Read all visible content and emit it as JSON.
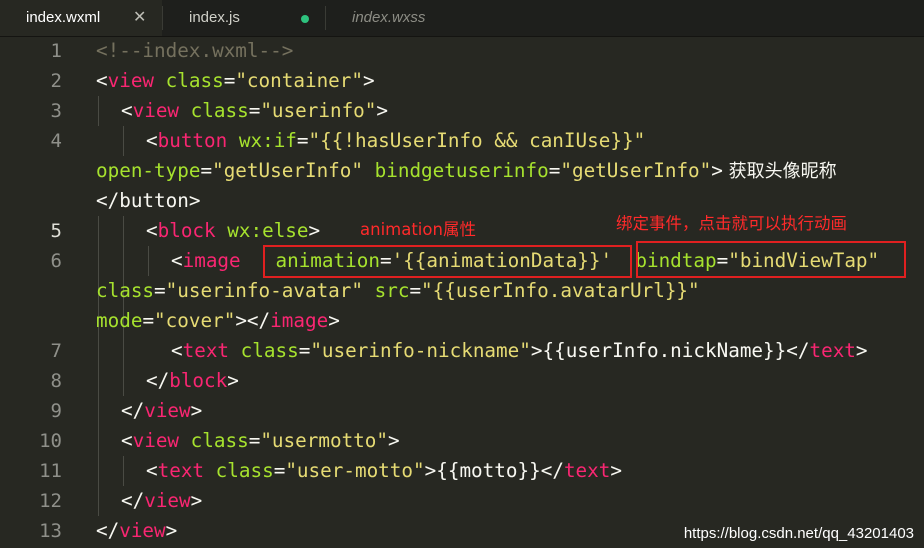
{
  "tabs": [
    {
      "label": "index.wxml",
      "close_glyph": "✕"
    },
    {
      "label": "index.js"
    },
    {
      "label": "index.wxss"
    }
  ],
  "line_numbers": [
    "1",
    "2",
    "3",
    "4",
    "5",
    "6",
    "7",
    "8",
    "9",
    "10",
    "11",
    "12",
    "13"
  ],
  "code": {
    "l1": "<!--index.wxml-->",
    "l2_lt": "<",
    "l2_tag": "view",
    "l2_attr": "class",
    "l2_val": "\"container\"",
    "l2_gt": ">",
    "l3_lt": "<",
    "l3_tag": "view",
    "l3_attr": "class",
    "l3_val": "\"userinfo\"",
    "l3_gt": ">",
    "l4_lt": "<",
    "l4_tag": "button",
    "l4_attr": "wx:if",
    "l4_val": "\"{{!hasUserInfo && canIUse}}\"",
    "l4b_attr1": "open-type",
    "l4b_val1": "\"getUserInfo\"",
    "l4b_attr2": "bindgetuserinfo",
    "l4b_val2": "\"getUserInfo\"",
    "l4b_gt": ">",
    "l4b_text": " 获取头像昵称",
    "l4c": "</button>",
    "l5_lt": "<",
    "l5_tag": "block",
    "l5_attr": "wx:else",
    "l5_gt": ">",
    "l6_lt": "<",
    "l6_tag": "image",
    "l6_attr1": "animation",
    "l6_val1": "'{{animationData}}'",
    "l6_attr2": "bindtap",
    "l6_val2": "\"bindViewTap\"",
    "l6b_attr1": "class",
    "l6b_val1": "\"userinfo-avatar\"",
    "l6b_attr2": "src",
    "l6b_val2": "\"{{userInfo.avatarUrl}}\"",
    "l6c_attr": "mode",
    "l6c_val": "\"cover\"",
    "l6c_close": "></",
    "l6c_tag": "image",
    "l6c_gt": ">",
    "l7_lt": "<",
    "l7_tag": "text",
    "l7_attr": "class",
    "l7_val": "\"userinfo-nickname\"",
    "l7_gt": ">",
    "l7_text": "{{userInfo.nickName}}",
    "l7_close": "</",
    "l7_ctag": "text",
    "l7_cgt": ">",
    "l8_lt": "</",
    "l8_tag": "block",
    "l8_gt": ">",
    "l9_lt": "</",
    "l9_tag": "view",
    "l9_gt": ">",
    "l10_lt": "<",
    "l10_tag": "view",
    "l10_attr": "class",
    "l10_val": "\"usermotto\"",
    "l10_gt": ">",
    "l11_lt": "<",
    "l11_tag": "text",
    "l11_attr": "class",
    "l11_val": "\"user-motto\"",
    "l11_gt": ">",
    "l11_text": "{{motto}}",
    "l11_close": "</",
    "l11_ctag": "text",
    "l11_cgt": ">",
    "l12_lt": "</",
    "l12_tag": "view",
    "l12_gt": ">",
    "l13_lt": "</",
    "l13_tag": "view",
    "l13_gt": ">"
  },
  "annotations": {
    "animation_label": "animation属性",
    "event_label": "绑定事件，点击就可以执行动画"
  },
  "watermark": "https://blog.csdn.net/qq_43201403",
  "colors": {
    "background": "#272822",
    "tag": "#f92672",
    "attribute": "#a6e22e",
    "string": "#e6db74",
    "comment": "#75715e",
    "annotation": "#e02020"
  }
}
